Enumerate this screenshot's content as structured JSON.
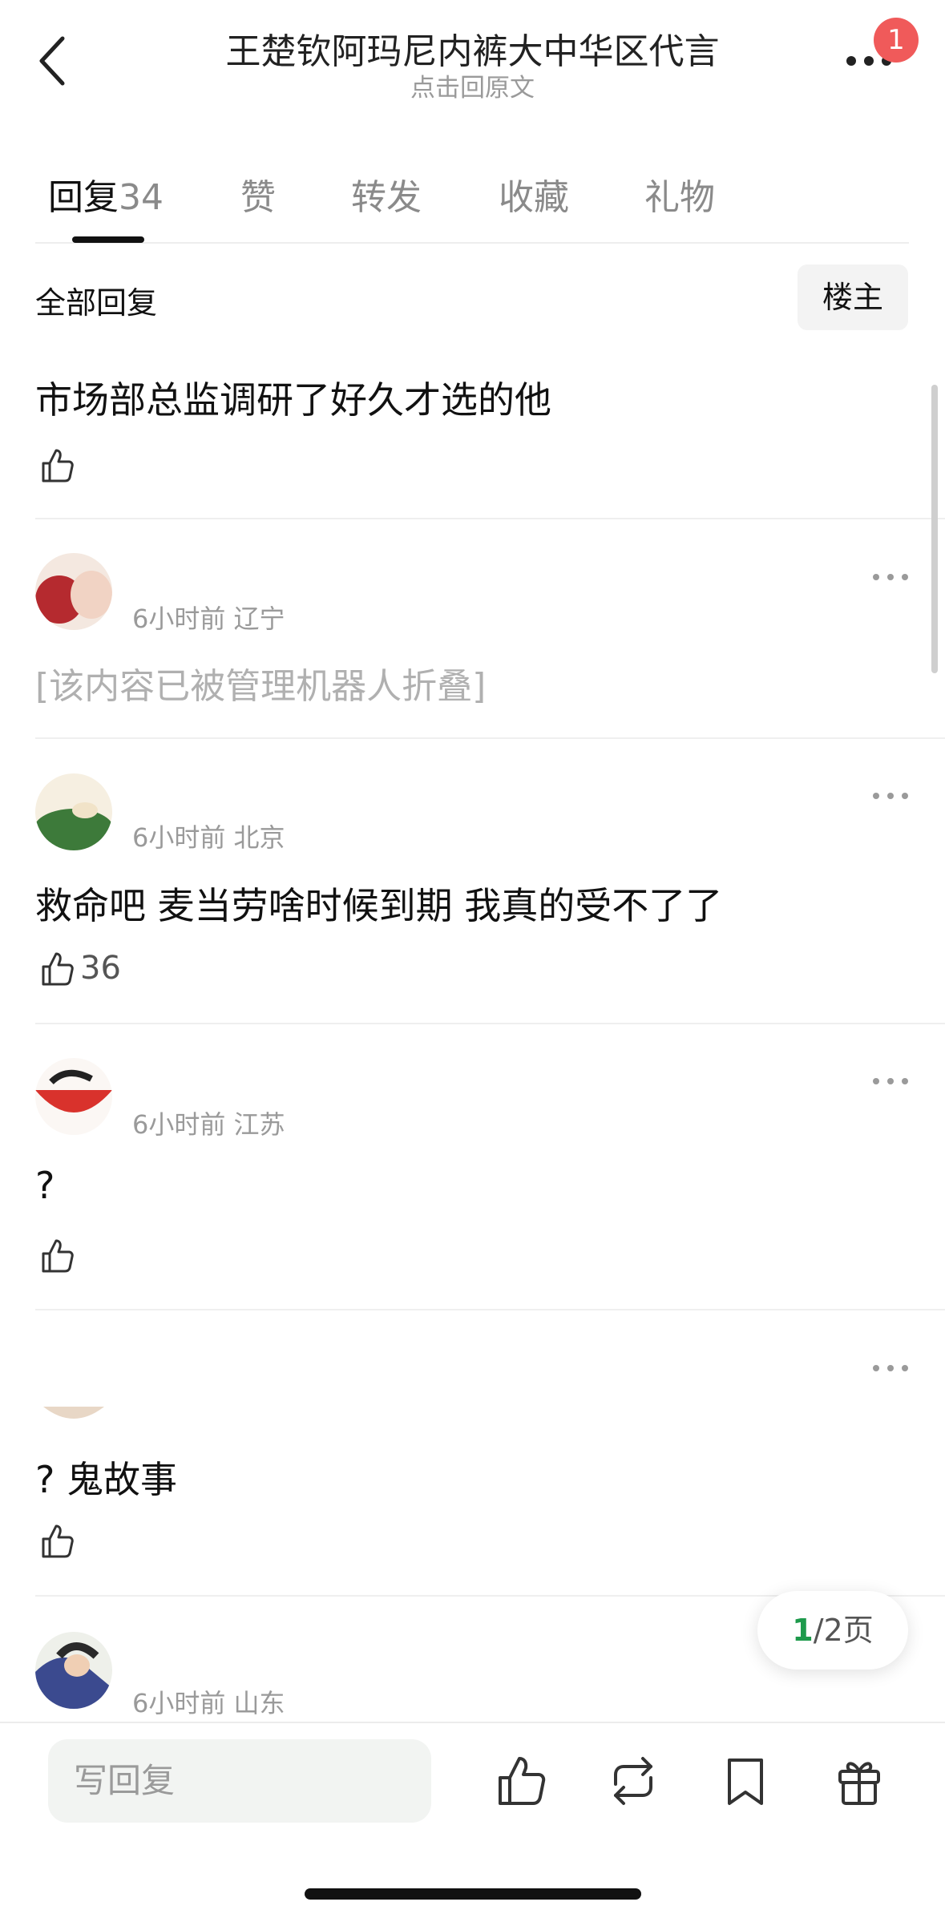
{
  "header": {
    "title": "王楚钦阿玛尼内裤大中华区代言",
    "subtitle": "点击回原文",
    "notification_count": "1"
  },
  "tabs": [
    {
      "label": "回复",
      "count": "34"
    },
    {
      "label": "赞"
    },
    {
      "label": "转发"
    },
    {
      "label": "收藏"
    },
    {
      "label": "礼物"
    }
  ],
  "filter": {
    "all_replies": "全部回复",
    "op_only": "楼主"
  },
  "comments": [
    {
      "text": "市场部总监调研了好久才选的他",
      "likes": ""
    },
    {
      "time": "6小时前",
      "location": "辽宁",
      "text": "[该内容已被管理机器人折叠]",
      "folded": true
    },
    {
      "time": "6小时前",
      "location": "北京",
      "text": "救命吧 麦当劳啥时候到期 我真的受不了了",
      "likes": "36"
    },
    {
      "time": "6小时前",
      "location": "江苏",
      "text": "?",
      "likes": ""
    },
    {
      "text": "? 鬼故事",
      "likes": ""
    },
    {
      "time": "6小时前",
      "location": "山东"
    }
  ],
  "pagination": {
    "current": "1",
    "total": "/2页"
  },
  "bottom_bar": {
    "reply_placeholder": "写回复"
  },
  "colors": {
    "accent_green": "#1e9a4c",
    "badge_red": "#f05a5a"
  }
}
